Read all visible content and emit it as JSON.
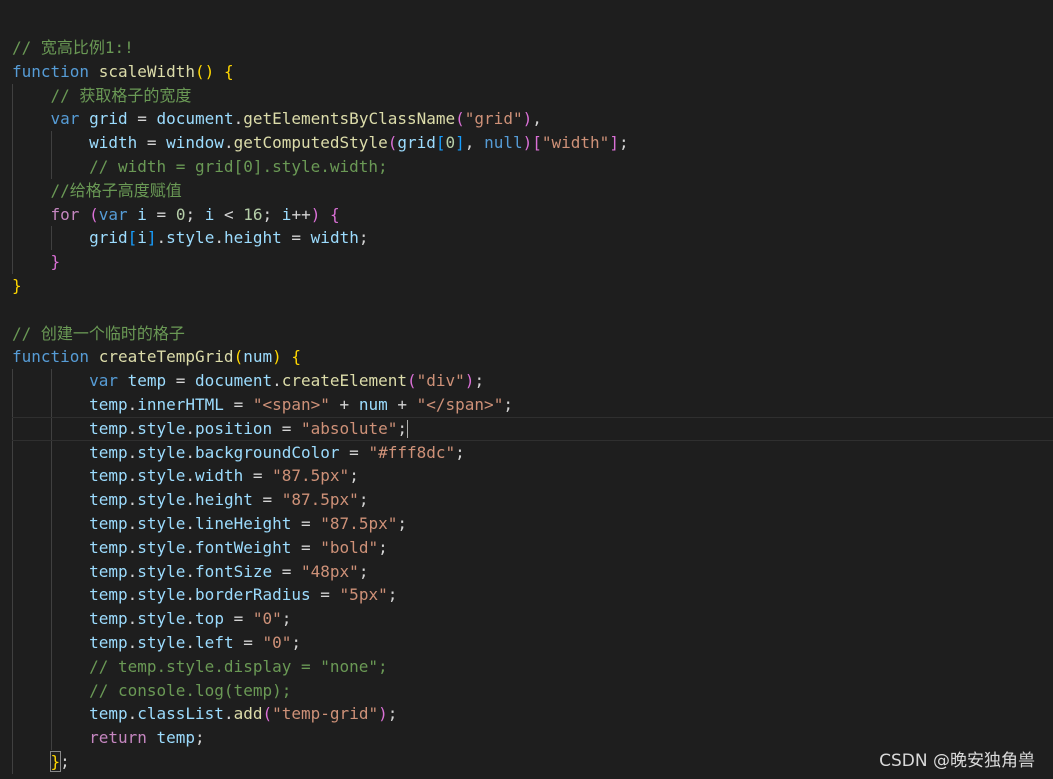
{
  "editor": {
    "background": "#1e1e1e",
    "lines": [
      [
        [
          "comment",
          "// 宽高比例1:!"
        ]
      ],
      [
        [
          "keyword",
          "function"
        ],
        [
          "punc",
          " "
        ],
        [
          "func",
          "scaleWidth"
        ],
        [
          "brace-gold",
          "()"
        ],
        [
          "punc",
          " "
        ],
        [
          "brace-gold",
          "{"
        ]
      ],
      [
        [
          "punc",
          "    "
        ],
        [
          "comment",
          "// 获取格子的宽度"
        ]
      ],
      [
        [
          "punc",
          "    "
        ],
        [
          "keyword",
          "var"
        ],
        [
          "punc",
          " "
        ],
        [
          "var",
          "grid"
        ],
        [
          "punc",
          " = "
        ],
        [
          "var",
          "document"
        ],
        [
          "punc",
          "."
        ],
        [
          "func",
          "getElementsByClassName"
        ],
        [
          "brace-pink",
          "("
        ],
        [
          "str",
          "\"grid\""
        ],
        [
          "brace-pink",
          ")"
        ],
        [
          "punc",
          ","
        ]
      ],
      [
        [
          "punc",
          "        "
        ],
        [
          "var",
          "width"
        ],
        [
          "punc",
          " = "
        ],
        [
          "var",
          "window"
        ],
        [
          "punc",
          "."
        ],
        [
          "func",
          "getComputedStyle"
        ],
        [
          "brace-pink",
          "("
        ],
        [
          "var",
          "grid"
        ],
        [
          "brace-blue",
          "["
        ],
        [
          "num",
          "0"
        ],
        [
          "brace-blue",
          "]"
        ],
        [
          "punc",
          ", "
        ],
        [
          "keyword",
          "null"
        ],
        [
          "brace-pink",
          ")"
        ],
        [
          "brace-pink",
          "["
        ],
        [
          "str",
          "\"width\""
        ],
        [
          "brace-pink",
          "]"
        ],
        [
          "punc",
          ";"
        ]
      ],
      [
        [
          "punc",
          "        "
        ],
        [
          "comment",
          "// width = grid[0].style.width;"
        ]
      ],
      [
        [
          "punc",
          "    "
        ],
        [
          "comment",
          "//给格子高度赋值"
        ]
      ],
      [
        [
          "punc",
          "    "
        ],
        [
          "control",
          "for"
        ],
        [
          "punc",
          " "
        ],
        [
          "brace-pink",
          "("
        ],
        [
          "keyword",
          "var"
        ],
        [
          "punc",
          " "
        ],
        [
          "var",
          "i"
        ],
        [
          "punc",
          " = "
        ],
        [
          "num",
          "0"
        ],
        [
          "punc",
          "; "
        ],
        [
          "var",
          "i"
        ],
        [
          "punc",
          " < "
        ],
        [
          "num",
          "16"
        ],
        [
          "punc",
          "; "
        ],
        [
          "var",
          "i"
        ],
        [
          "punc",
          "++"
        ],
        [
          "brace-pink",
          ")"
        ],
        [
          "punc",
          " "
        ],
        [
          "brace-pink",
          "{"
        ]
      ],
      [
        [
          "punc",
          "        "
        ],
        [
          "var",
          "grid"
        ],
        [
          "brace-blue",
          "["
        ],
        [
          "var",
          "i"
        ],
        [
          "brace-blue",
          "]"
        ],
        [
          "punc",
          "."
        ],
        [
          "var",
          "style"
        ],
        [
          "punc",
          "."
        ],
        [
          "var",
          "height"
        ],
        [
          "punc",
          " = "
        ],
        [
          "var",
          "width"
        ],
        [
          "punc",
          ";"
        ]
      ],
      [
        [
          "punc",
          "    "
        ],
        [
          "brace-pink",
          "}"
        ]
      ],
      [
        [
          "brace-gold",
          "}"
        ]
      ],
      [
        [
          "punc",
          ""
        ]
      ],
      [
        [
          "comment",
          "// 创建一个临时的格子"
        ]
      ],
      [
        [
          "keyword",
          "function"
        ],
        [
          "punc",
          " "
        ],
        [
          "func",
          "createTempGrid"
        ],
        [
          "brace-gold",
          "("
        ],
        [
          "var",
          "num"
        ],
        [
          "brace-gold",
          ")"
        ],
        [
          "punc",
          " "
        ],
        [
          "brace-gold",
          "{"
        ]
      ],
      [
        [
          "punc",
          "        "
        ],
        [
          "keyword",
          "var"
        ],
        [
          "punc",
          " "
        ],
        [
          "var",
          "temp"
        ],
        [
          "punc",
          " = "
        ],
        [
          "var",
          "document"
        ],
        [
          "punc",
          "."
        ],
        [
          "func",
          "createElement"
        ],
        [
          "brace-pink",
          "("
        ],
        [
          "str",
          "\"div\""
        ],
        [
          "brace-pink",
          ")"
        ],
        [
          "punc",
          ";"
        ]
      ],
      [
        [
          "punc",
          "        "
        ],
        [
          "var",
          "temp"
        ],
        [
          "punc",
          "."
        ],
        [
          "var",
          "innerHTML"
        ],
        [
          "punc",
          " = "
        ],
        [
          "str",
          "\"<span>\""
        ],
        [
          "punc",
          " + "
        ],
        [
          "var",
          "num"
        ],
        [
          "punc",
          " + "
        ],
        [
          "str",
          "\"</span>\""
        ],
        [
          "punc",
          ";"
        ]
      ],
      [
        [
          "punc",
          "        "
        ],
        [
          "var",
          "temp"
        ],
        [
          "punc",
          "."
        ],
        [
          "var",
          "style"
        ],
        [
          "punc",
          "."
        ],
        [
          "var",
          "position"
        ],
        [
          "punc",
          " = "
        ],
        [
          "str",
          "\"absolute\""
        ],
        [
          "punc",
          ";"
        ],
        [
          "caret",
          ""
        ]
      ],
      [
        [
          "punc",
          "        "
        ],
        [
          "var",
          "temp"
        ],
        [
          "punc",
          "."
        ],
        [
          "var",
          "style"
        ],
        [
          "punc",
          "."
        ],
        [
          "var",
          "backgroundColor"
        ],
        [
          "punc",
          " = "
        ],
        [
          "str",
          "\"#fff8dc\""
        ],
        [
          "punc",
          ";"
        ]
      ],
      [
        [
          "punc",
          "        "
        ],
        [
          "var",
          "temp"
        ],
        [
          "punc",
          "."
        ],
        [
          "var",
          "style"
        ],
        [
          "punc",
          "."
        ],
        [
          "var",
          "width"
        ],
        [
          "punc",
          " = "
        ],
        [
          "str",
          "\"87.5px\""
        ],
        [
          "punc",
          ";"
        ]
      ],
      [
        [
          "punc",
          "        "
        ],
        [
          "var",
          "temp"
        ],
        [
          "punc",
          "."
        ],
        [
          "var",
          "style"
        ],
        [
          "punc",
          "."
        ],
        [
          "var",
          "height"
        ],
        [
          "punc",
          " = "
        ],
        [
          "str",
          "\"87.5px\""
        ],
        [
          "punc",
          ";"
        ]
      ],
      [
        [
          "punc",
          "        "
        ],
        [
          "var",
          "temp"
        ],
        [
          "punc",
          "."
        ],
        [
          "var",
          "style"
        ],
        [
          "punc",
          "."
        ],
        [
          "var",
          "lineHeight"
        ],
        [
          "punc",
          " = "
        ],
        [
          "str",
          "\"87.5px\""
        ],
        [
          "punc",
          ";"
        ]
      ],
      [
        [
          "punc",
          "        "
        ],
        [
          "var",
          "temp"
        ],
        [
          "punc",
          "."
        ],
        [
          "var",
          "style"
        ],
        [
          "punc",
          "."
        ],
        [
          "var",
          "fontWeight"
        ],
        [
          "punc",
          " = "
        ],
        [
          "str",
          "\"bold\""
        ],
        [
          "punc",
          ";"
        ]
      ],
      [
        [
          "punc",
          "        "
        ],
        [
          "var",
          "temp"
        ],
        [
          "punc",
          "."
        ],
        [
          "var",
          "style"
        ],
        [
          "punc",
          "."
        ],
        [
          "var",
          "fontSize"
        ],
        [
          "punc",
          " = "
        ],
        [
          "str",
          "\"48px\""
        ],
        [
          "punc",
          ";"
        ]
      ],
      [
        [
          "punc",
          "        "
        ],
        [
          "var",
          "temp"
        ],
        [
          "punc",
          "."
        ],
        [
          "var",
          "style"
        ],
        [
          "punc",
          "."
        ],
        [
          "var",
          "borderRadius"
        ],
        [
          "punc",
          " = "
        ],
        [
          "str",
          "\"5px\""
        ],
        [
          "punc",
          ";"
        ]
      ],
      [
        [
          "punc",
          "        "
        ],
        [
          "var",
          "temp"
        ],
        [
          "punc",
          "."
        ],
        [
          "var",
          "style"
        ],
        [
          "punc",
          "."
        ],
        [
          "var",
          "top"
        ],
        [
          "punc",
          " = "
        ],
        [
          "str",
          "\"0\""
        ],
        [
          "punc",
          ";"
        ]
      ],
      [
        [
          "punc",
          "        "
        ],
        [
          "var",
          "temp"
        ],
        [
          "punc",
          "."
        ],
        [
          "var",
          "style"
        ],
        [
          "punc",
          "."
        ],
        [
          "var",
          "left"
        ],
        [
          "punc",
          " = "
        ],
        [
          "str",
          "\"0\""
        ],
        [
          "punc",
          ";"
        ]
      ],
      [
        [
          "punc",
          "        "
        ],
        [
          "comment",
          "// temp.style.display = \"none\";"
        ]
      ],
      [
        [
          "punc",
          "        "
        ],
        [
          "comment",
          "// console.log(temp);"
        ]
      ],
      [
        [
          "punc",
          "        "
        ],
        [
          "var",
          "temp"
        ],
        [
          "punc",
          "."
        ],
        [
          "var",
          "classList"
        ],
        [
          "punc",
          "."
        ],
        [
          "func",
          "add"
        ],
        [
          "brace-pink",
          "("
        ],
        [
          "str",
          "\"temp-grid\""
        ],
        [
          "brace-pink",
          ")"
        ],
        [
          "punc",
          ";"
        ]
      ],
      [
        [
          "punc",
          "        "
        ],
        [
          "control",
          "return"
        ],
        [
          "punc",
          " "
        ],
        [
          "var",
          "temp"
        ],
        [
          "punc",
          ";"
        ]
      ],
      [
        [
          "punc",
          "    "
        ],
        [
          "brace-gold-match",
          "}"
        ],
        [
          "punc",
          ";"
        ]
      ]
    ],
    "current_line_index": 16
  },
  "watermark": {
    "text": "CSDN @晚安独角兽"
  }
}
